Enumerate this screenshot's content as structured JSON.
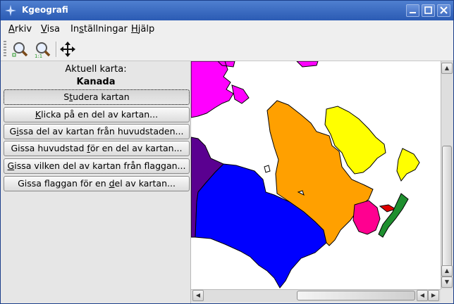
{
  "window": {
    "title": "Kgeografi"
  },
  "menu": [
    {
      "pre": "",
      "ul": "A",
      "post": "rkiv"
    },
    {
      "pre": "",
      "ul": "V",
      "post": "isa"
    },
    {
      "pre": "In",
      "ul": "s",
      "post": "tällningar"
    },
    {
      "pre": "",
      "ul": "H",
      "post": "jälp"
    }
  ],
  "toolbar": {
    "zoom_icon": "zoom-fit-icon",
    "zoom_original_icon": "zoom-original-icon",
    "move_icon": "move-icon"
  },
  "panel": {
    "current_map_label": "Aktuell karta:",
    "current_map_name": "Kanada",
    "buttons": [
      {
        "pre": "S",
        "ul": "t",
        "post": "udera kartan"
      },
      {
        "pre": "",
        "ul": "K",
        "post": "licka på en del av kartan..."
      },
      {
        "pre": "G",
        "ul": "i",
        "post": "ssa del av kartan från huvudstaden..."
      },
      {
        "pre": "Gissa huvudstad ",
        "ul": "f",
        "post": "ör en del av kartan..."
      },
      {
        "pre": "",
        "ul": "G",
        "post": "issa vilken del av kartan från flaggan..."
      },
      {
        "pre": "Gissa flaggan för en ",
        "ul": "d",
        "post": "el av kartan..."
      }
    ]
  },
  "map": {
    "colors": {
      "nunavut": "#ff00ff",
      "quebec": "#ffa000",
      "ontario": "#0000ff",
      "manitoba": "#5a0090",
      "newfoundland": "#ffff00",
      "new_brunswick": "#ff0090",
      "nova_scotia": "#1f8f2f",
      "pei": "#e00000"
    }
  }
}
